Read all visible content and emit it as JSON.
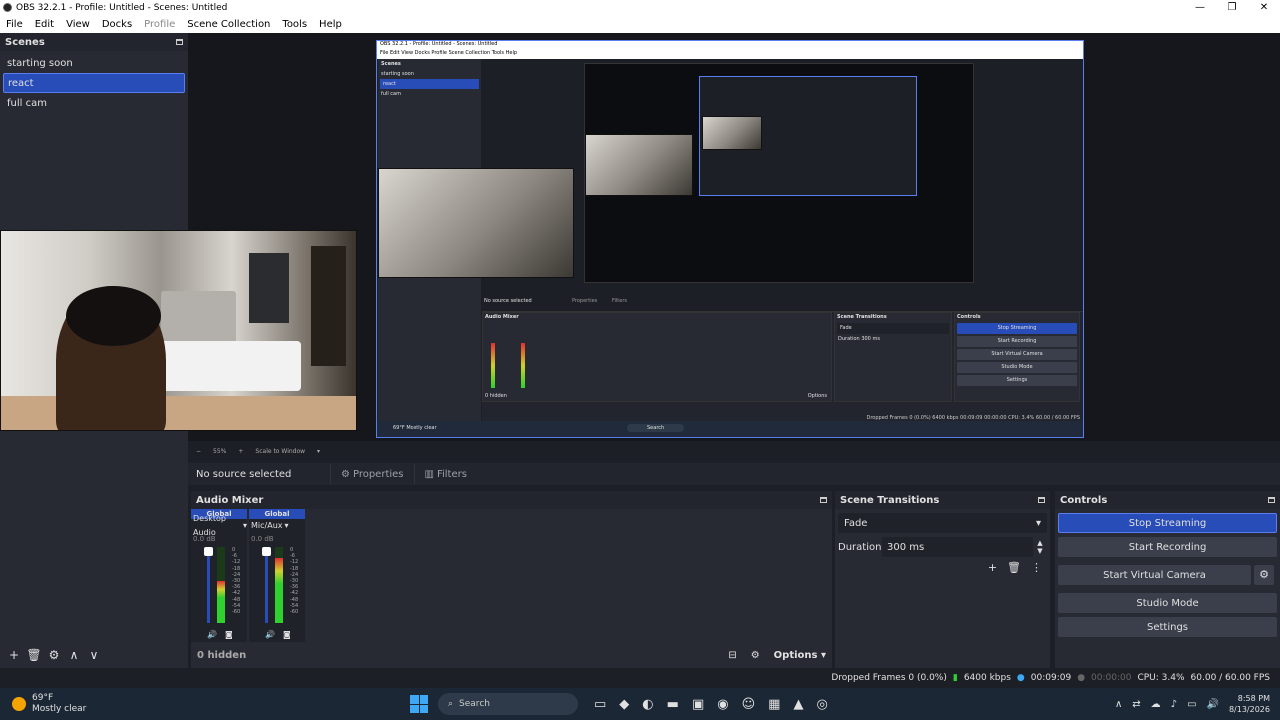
{
  "window": {
    "title": "OBS 32.2.1 - Profile: Untitled - Scenes: Untitled",
    "minimize": "—",
    "maximize": "❐",
    "close": "✕"
  },
  "menu": [
    "File",
    "Edit",
    "View",
    "Docks",
    "Profile",
    "Scene Collection",
    "Tools",
    "Help"
  ],
  "scenes": {
    "title": "Scenes",
    "items": [
      "starting soon",
      "react",
      "full cam"
    ],
    "selected": "react",
    "toolbar": [
      "+",
      "🗑",
      "⚙",
      "∧",
      "∨"
    ]
  },
  "nested_preview": {
    "title": "OBS 32.2.1 - Profile: Untitled - Scenes: Untitled",
    "menu": "File   Edit   View   Docks   Profile   Scene Collection   Tools   Help",
    "scenes_header": "Scenes",
    "scenes": [
      "starting soon",
      "react",
      "full cam"
    ],
    "no_source": "No source selected",
    "properties": "Properties",
    "filters": "Filters",
    "audio_mixer": "Audio Mixer",
    "scene_transitions": "Scene Transitions",
    "controls": "Controls",
    "fade": "Fade",
    "duration": "Duration",
    "duration_value": "300 ms",
    "buttons": [
      "Stop Streaming",
      "Start Recording",
      "Start Virtual Camera",
      "Studio Mode",
      "Settings"
    ],
    "hidden": "0 hidden",
    "options": "Options",
    "status": "Dropped Frames 0 (0.0%)   6400 kbps   00:09:09   00:00:00   CPU: 3.4%   60.00 / 60.00 FPS",
    "weather": "69°F Mostly clear",
    "search": "Search"
  },
  "preview_controls": {
    "zoom": "55%",
    "scale": "Scale to Window"
  },
  "source_bar": {
    "no_source": "No source selected",
    "properties": "Properties",
    "filters": "Filters"
  },
  "audio_mixer": {
    "title": "Audio Mixer",
    "channels": [
      {
        "head": "Global",
        "name": "Desktop Audio",
        "db": "0.0 dB",
        "level": 0.55
      },
      {
        "head": "Global",
        "name": "Mic/Aux",
        "db": "0.0 dB",
        "level": 0.85
      }
    ],
    "scale": [
      "0",
      "-6",
      "-12",
      "-18",
      "-24",
      "-30",
      "-36",
      "-42",
      "-48",
      "-54",
      "-60"
    ],
    "hidden": "0 hidden",
    "options": "Options"
  },
  "transitions": {
    "title": "Scene Transitions",
    "selected": "Fade",
    "duration_label": "Duration",
    "duration_value": "300 ms"
  },
  "controls": {
    "title": "Controls",
    "stop_streaming": "Stop Streaming",
    "start_recording": "Start Recording",
    "start_virtual_camera": "Start Virtual Camera",
    "studio_mode": "Studio Mode",
    "settings": "Settings"
  },
  "status": {
    "dropped": "Dropped Frames 0 (0.0%)",
    "bitrate": "6400 kbps",
    "stream_time": "00:09:09",
    "rec_time": "00:00:00",
    "cpu": "CPU: 3.4%",
    "fps": "60.00 / 60.00 FPS"
  },
  "taskbar": {
    "temp": "69°F",
    "condition": "Mostly clear",
    "search": "Search",
    "time": "8:58 PM",
    "date": "8/13/2026"
  }
}
